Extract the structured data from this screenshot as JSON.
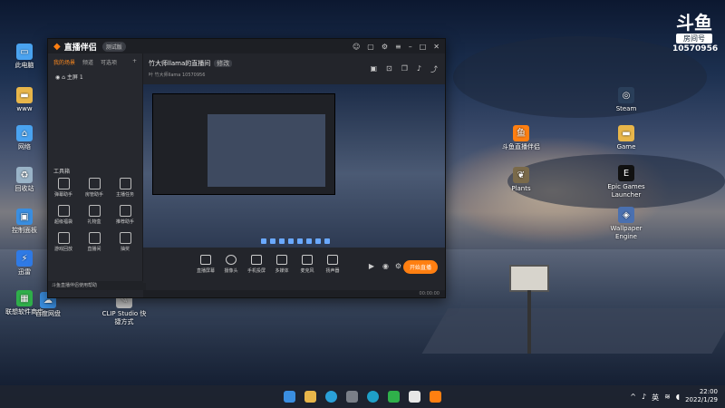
{
  "desktop": {
    "left_icons": [
      {
        "label": "此电脑",
        "color": "#4aa3f0",
        "icon": "monitor-icon"
      },
      {
        "label": "www",
        "color": "#e8b64a",
        "icon": "folder-icon"
      },
      {
        "label": "网络",
        "color": "#4aa3f0",
        "icon": "network-icon"
      },
      {
        "label": "回收站",
        "color": "#9ab4c8",
        "icon": "recycle-bin-icon"
      },
      {
        "label": "控制面板",
        "color": "#3a8ee0",
        "icon": "control-panel-icon"
      },
      {
        "label": "迅雷",
        "color": "#2f7ae5",
        "icon": "thunder-icon"
      },
      {
        "label": "联想软件商店",
        "color": "#2fae4a",
        "icon": "store-icon"
      }
    ],
    "bottom_icons": [
      {
        "label": "百度网盘",
        "color": "#3a8ee0"
      },
      {
        "label": "CLIP Studio 快捷方式",
        "color": "#c9c9c9"
      }
    ],
    "right_icons": [
      {
        "label": "Steam",
        "color": "#2a3f5a",
        "icon": "steam-icon"
      },
      {
        "label": "Game",
        "color": "#e8b64a",
        "icon": "folder-icon"
      },
      {
        "label": "Epic Games Launcher",
        "color": "#111111",
        "icon": "epic-icon"
      },
      {
        "label": "Wallpaper Engine",
        "color": "#4a70b0",
        "icon": "wallpaper-engine-icon"
      }
    ],
    "mid_icons": [
      {
        "label": "斗鱼直播伴侣",
        "color": "#ff7f11"
      },
      {
        "label": "Plants",
        "color": "#7a6a4a"
      }
    ],
    "brand": {
      "mark": "斗鱼",
      "room_label": "房间号",
      "room_number": "10570956"
    }
  },
  "app": {
    "title": "直播伴侣",
    "version": "测试版",
    "tabs": [
      "我的场景",
      "频道",
      "可选项"
    ],
    "scene": "主屏 1",
    "tools_header": "工具箱",
    "tools": [
      "弹幕助手",
      "房管助手",
      "主播任务",
      "超级福袋",
      "礼物盒",
      "推荐助手",
      "游戏回放",
      "直播间",
      "抽奖"
    ],
    "notice": "斗鱼直播伴侣使用帮助",
    "room_title": "竹大师llama的直播间",
    "room_tag": "修改",
    "room_sub": "叶 竹大师llama  10570956",
    "controls": [
      "直播屏幕",
      "摄像头",
      "手机投屏",
      "多媒体",
      "麦克风",
      "扬声器"
    ],
    "start_label": "开始直播",
    "status": "00:00:00",
    "accent": "#ff7f11"
  },
  "taskbar": {
    "time": "22:00",
    "date": "2022/1/29",
    "lang": "英"
  }
}
